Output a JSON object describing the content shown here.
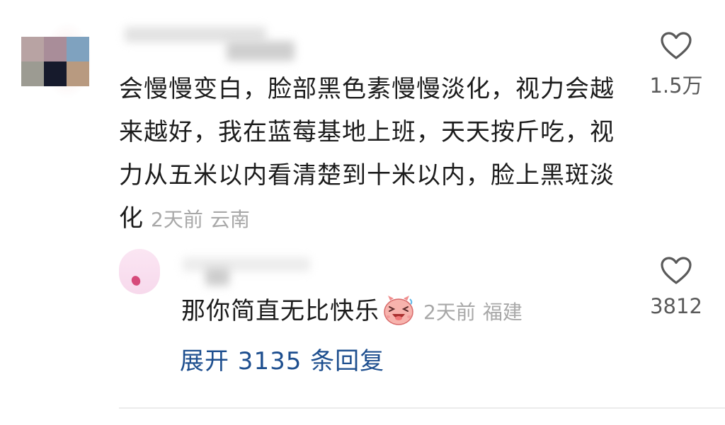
{
  "comment": {
    "text": "会慢慢变白，脸部黑色素慢慢淡化，视力会越来越好，我在蓝莓基地上班，天天按斤吃，视力从五米以内看清楚到十米以内，脸上黑斑淡化",
    "time": "2天前",
    "location": "云南",
    "likes": "1.5万",
    "avatar_icon": "mosaic-avatar",
    "avatar_colors": [
      "#b8a3a3",
      "#a98d99",
      "#7fa2bf",
      "#9c9b92",
      "#161a2c",
      "#b89a80"
    ]
  },
  "reply": {
    "text": "那你简直无比快乐",
    "emoji": "laughing-pig-emoji",
    "time": "2天前",
    "location": "福建",
    "likes": "3812",
    "avatar_icon": "pink-avatar"
  },
  "expand_replies": {
    "label": "展开 3135 条回复"
  },
  "colors": {
    "text": "#1c1c1c",
    "meta": "#a8a8a8",
    "like_count": "#5a5a5a",
    "link": "#1e4f8f",
    "divider": "#ececec"
  },
  "icons": [
    "heart-outline-icon",
    "laughing-pig-emoji"
  ]
}
